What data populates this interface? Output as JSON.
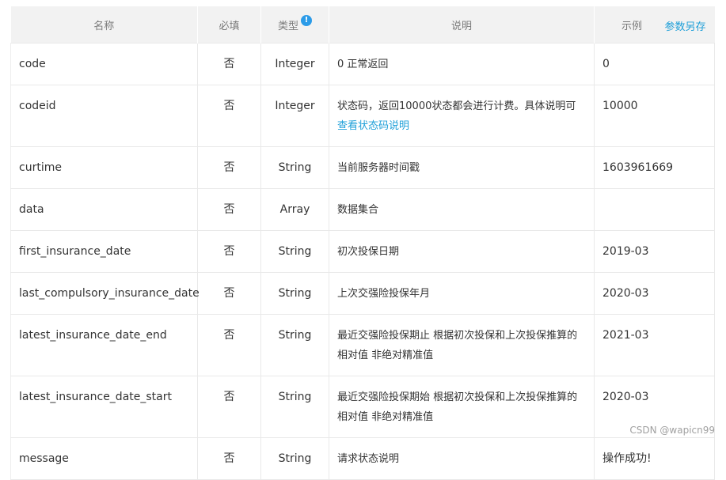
{
  "header": {
    "name": "名称",
    "required": "必填",
    "type": "类型",
    "type_info_icon": "!",
    "description": "说明",
    "example": "示例",
    "save_as": "参数另存"
  },
  "rows": [
    {
      "name": "code",
      "required": "否",
      "type": "Integer",
      "description": "0 正常返回",
      "description_link": "",
      "example": "0"
    },
    {
      "name": "codeid",
      "required": "否",
      "type": "Integer",
      "description": "状态码，返回10000状态都会进行计费。具体说明可",
      "description_link": "查看状态码说明",
      "example": "10000"
    },
    {
      "name": "curtime",
      "required": "否",
      "type": "String",
      "description": "当前服务器时间戳",
      "description_link": "",
      "example": "1603961669"
    },
    {
      "name": "data",
      "required": "否",
      "type": "Array",
      "description": "数据集合",
      "description_link": "",
      "example": ""
    },
    {
      "name": "first_insurance_date",
      "required": "否",
      "type": "String",
      "description": "初次投保日期",
      "description_link": "",
      "example": "2019-03"
    },
    {
      "name": "last_compulsory_insurance_date",
      "required": "否",
      "type": "String",
      "description": "上次交强险投保年月",
      "description_link": "",
      "example": "2020-03"
    },
    {
      "name": "latest_insurance_date_end",
      "required": "否",
      "type": "String",
      "description": "最近交强险投保期止 根据初次投保和上次投保推算的相对值 非绝对精准值",
      "description_link": "",
      "example": "2021-03"
    },
    {
      "name": "latest_insurance_date_start",
      "required": "否",
      "type": "String",
      "description": "最近交强险投保期始 根据初次投保和上次投保推算的相对值 非绝对精准值",
      "description_link": "",
      "example": "2020-03"
    },
    {
      "name": "message",
      "required": "否",
      "type": "String",
      "description": "请求状态说明",
      "description_link": "",
      "example": "操作成功!"
    }
  ],
  "watermark": "CSDN @wapicn99",
  "colors": {
    "link": "#1e9fd8",
    "header_bg": "#f2f2f2",
    "info_icon": "#2b9be8"
  }
}
